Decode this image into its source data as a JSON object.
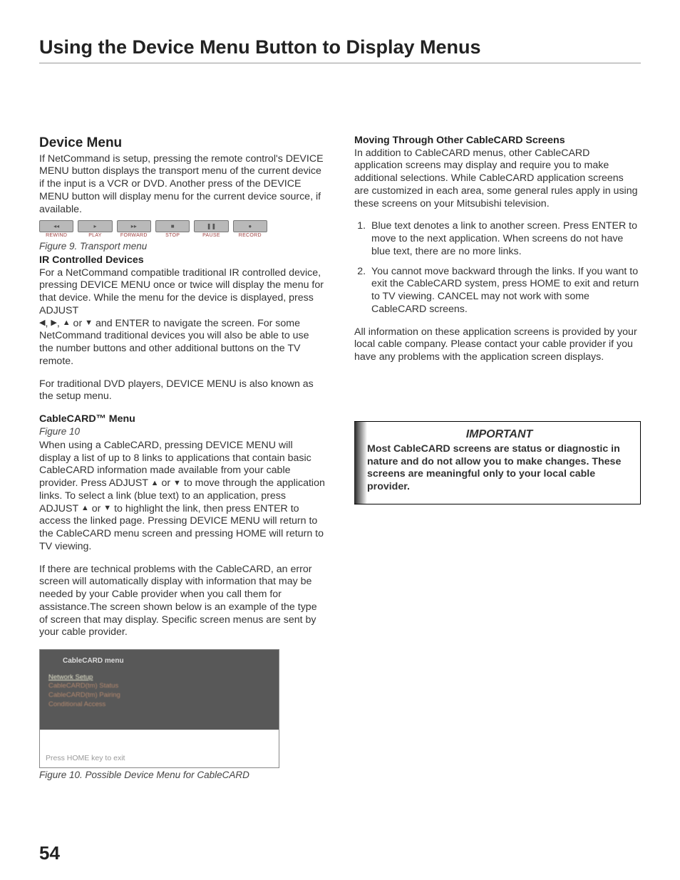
{
  "page_title": "Using the Device Menu Button to Display Menus",
  "page_number": "54",
  "left": {
    "h2": "Device Menu",
    "intro": "If NetCommand is setup, pressing the remote control's DEVICE MENU button displays the transport menu of the current device if the input is a VCR or DVD. Another press of the DEVICE MENU button will display menu for the current device source, if available.",
    "transport_buttons": [
      {
        "sym": "◂◂",
        "lbl": "REWIND"
      },
      {
        "sym": "▸",
        "lbl": "PLAY"
      },
      {
        "sym": "▸▸",
        "lbl": "FORWARD"
      },
      {
        "sym": "■",
        "lbl": "STOP"
      },
      {
        "sym": "❚❚",
        "lbl": "PAUSE"
      },
      {
        "sym": "●",
        "lbl": "RECORD"
      }
    ],
    "fig9": "Figure 9. Transport menu",
    "ir_head": "IR Controlled Devices",
    "ir_p1a": "For a NetCommand compatible traditional IR controlled device, pressing DEVICE MENU once or twice will display the menu for that device.  While the menu for the device is displayed, press ADJUST",
    "ir_p1b_pre": "",
    "ir_p1b": " and ENTER to navigate the screen.  For some NetCommand traditional devices you will also be able to use the number buttons and other additional buttons on the TV remote.",
    "ir_p2": "For traditional DVD players, DEVICE MENU is also known as the setup menu.",
    "cc_head": "CableCARD™ Menu",
    "cc_fig_ref": "Figure 10",
    "cc_p1a": "When using a CableCARD, pressing DEVICE MENU will display a list of up to 8 links to applications that contain basic CableCARD information made available from your cable provider.  Press ADJUST ",
    "cc_p1b": " to move through the application links.  To select a link (blue text) to an application, press ADJUST ",
    "cc_p1c": " to highlight the link, then press ENTER to access the linked page.  Pressing DEVICE MENU will return to the CableCARD menu screen and pressing HOME will return to TV viewing.",
    "cc_p2": "If there are technical problems with the CableCARD, an error screen will automatically display with information that may be needed by your Cable provider when you call them for assistance.The screen shown below is an example of the type of screen that may display.  Specific screen menus are sent by your cable provider.",
    "cc_menu": {
      "title": "CableCARD menu",
      "items": [
        "Network Setup",
        "CableCARD(tm) Status",
        "CableCARD(tm) Pairing",
        "Conditional Access"
      ],
      "footer": "Press HOME key to exit"
    },
    "fig10": "Figure 10. Possible Device Menu for CableCARD"
  },
  "right": {
    "mv_head": "Moving Through Other CableCARD Screens",
    "mv_p1": "In addition to CableCARD menus, other CableCARD application screens may display and require you to make additional selections.  While CableCARD application screens are customized in each area, some general rules apply in using these screens on your Mitsubishi television.",
    "list": [
      "Blue text denotes a link to another screen. Press ENTER to move to the next application. When screens do not have blue text, there are no more links.",
      "You cannot move backward through the links.  If you want to exit the CableCARD system, press HOME to exit  and return to TV viewing.  CANCEL may not work with some CableCARD screens."
    ],
    "mv_p2": "All information on these application screens is provided by your local cable company.  Please contact your cable provider if you have any problems with the application screen displays.",
    "important_title": "IMPORTANT",
    "important_body": "Most CableCARD screens are status or diagnostic in nature and do not allow you to make changes.  These screens are meaningful only to your local cable provider."
  }
}
